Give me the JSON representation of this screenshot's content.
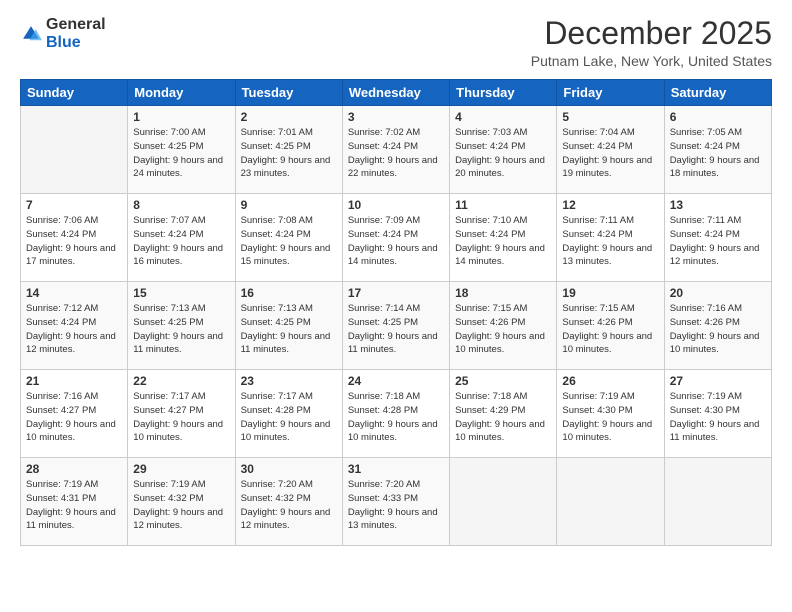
{
  "logo": {
    "general": "General",
    "blue": "Blue"
  },
  "header": {
    "month": "December 2025",
    "location": "Putnam Lake, New York, United States"
  },
  "weekdays": [
    "Sunday",
    "Monday",
    "Tuesday",
    "Wednesday",
    "Thursday",
    "Friday",
    "Saturday"
  ],
  "weeks": [
    [
      {
        "day": "",
        "sunrise": "",
        "sunset": "",
        "daylight": ""
      },
      {
        "day": "1",
        "sunrise": "Sunrise: 7:00 AM",
        "sunset": "Sunset: 4:25 PM",
        "daylight": "Daylight: 9 hours and 24 minutes."
      },
      {
        "day": "2",
        "sunrise": "Sunrise: 7:01 AM",
        "sunset": "Sunset: 4:25 PM",
        "daylight": "Daylight: 9 hours and 23 minutes."
      },
      {
        "day": "3",
        "sunrise": "Sunrise: 7:02 AM",
        "sunset": "Sunset: 4:24 PM",
        "daylight": "Daylight: 9 hours and 22 minutes."
      },
      {
        "day": "4",
        "sunrise": "Sunrise: 7:03 AM",
        "sunset": "Sunset: 4:24 PM",
        "daylight": "Daylight: 9 hours and 20 minutes."
      },
      {
        "day": "5",
        "sunrise": "Sunrise: 7:04 AM",
        "sunset": "Sunset: 4:24 PM",
        "daylight": "Daylight: 9 hours and 19 minutes."
      },
      {
        "day": "6",
        "sunrise": "Sunrise: 7:05 AM",
        "sunset": "Sunset: 4:24 PM",
        "daylight": "Daylight: 9 hours and 18 minutes."
      }
    ],
    [
      {
        "day": "7",
        "sunrise": "Sunrise: 7:06 AM",
        "sunset": "Sunset: 4:24 PM",
        "daylight": "Daylight: 9 hours and 17 minutes."
      },
      {
        "day": "8",
        "sunrise": "Sunrise: 7:07 AM",
        "sunset": "Sunset: 4:24 PM",
        "daylight": "Daylight: 9 hours and 16 minutes."
      },
      {
        "day": "9",
        "sunrise": "Sunrise: 7:08 AM",
        "sunset": "Sunset: 4:24 PM",
        "daylight": "Daylight: 9 hours and 15 minutes."
      },
      {
        "day": "10",
        "sunrise": "Sunrise: 7:09 AM",
        "sunset": "Sunset: 4:24 PM",
        "daylight": "Daylight: 9 hours and 14 minutes."
      },
      {
        "day": "11",
        "sunrise": "Sunrise: 7:10 AM",
        "sunset": "Sunset: 4:24 PM",
        "daylight": "Daylight: 9 hours and 14 minutes."
      },
      {
        "day": "12",
        "sunrise": "Sunrise: 7:11 AM",
        "sunset": "Sunset: 4:24 PM",
        "daylight": "Daylight: 9 hours and 13 minutes."
      },
      {
        "day": "13",
        "sunrise": "Sunrise: 7:11 AM",
        "sunset": "Sunset: 4:24 PM",
        "daylight": "Daylight: 9 hours and 12 minutes."
      }
    ],
    [
      {
        "day": "14",
        "sunrise": "Sunrise: 7:12 AM",
        "sunset": "Sunset: 4:24 PM",
        "daylight": "Daylight: 9 hours and 12 minutes."
      },
      {
        "day": "15",
        "sunrise": "Sunrise: 7:13 AM",
        "sunset": "Sunset: 4:25 PM",
        "daylight": "Daylight: 9 hours and 11 minutes."
      },
      {
        "day": "16",
        "sunrise": "Sunrise: 7:13 AM",
        "sunset": "Sunset: 4:25 PM",
        "daylight": "Daylight: 9 hours and 11 minutes."
      },
      {
        "day": "17",
        "sunrise": "Sunrise: 7:14 AM",
        "sunset": "Sunset: 4:25 PM",
        "daylight": "Daylight: 9 hours and 11 minutes."
      },
      {
        "day": "18",
        "sunrise": "Sunrise: 7:15 AM",
        "sunset": "Sunset: 4:26 PM",
        "daylight": "Daylight: 9 hours and 10 minutes."
      },
      {
        "day": "19",
        "sunrise": "Sunrise: 7:15 AM",
        "sunset": "Sunset: 4:26 PM",
        "daylight": "Daylight: 9 hours and 10 minutes."
      },
      {
        "day": "20",
        "sunrise": "Sunrise: 7:16 AM",
        "sunset": "Sunset: 4:26 PM",
        "daylight": "Daylight: 9 hours and 10 minutes."
      }
    ],
    [
      {
        "day": "21",
        "sunrise": "Sunrise: 7:16 AM",
        "sunset": "Sunset: 4:27 PM",
        "daylight": "Daylight: 9 hours and 10 minutes."
      },
      {
        "day": "22",
        "sunrise": "Sunrise: 7:17 AM",
        "sunset": "Sunset: 4:27 PM",
        "daylight": "Daylight: 9 hours and 10 minutes."
      },
      {
        "day": "23",
        "sunrise": "Sunrise: 7:17 AM",
        "sunset": "Sunset: 4:28 PM",
        "daylight": "Daylight: 9 hours and 10 minutes."
      },
      {
        "day": "24",
        "sunrise": "Sunrise: 7:18 AM",
        "sunset": "Sunset: 4:28 PM",
        "daylight": "Daylight: 9 hours and 10 minutes."
      },
      {
        "day": "25",
        "sunrise": "Sunrise: 7:18 AM",
        "sunset": "Sunset: 4:29 PM",
        "daylight": "Daylight: 9 hours and 10 minutes."
      },
      {
        "day": "26",
        "sunrise": "Sunrise: 7:19 AM",
        "sunset": "Sunset: 4:30 PM",
        "daylight": "Daylight: 9 hours and 10 minutes."
      },
      {
        "day": "27",
        "sunrise": "Sunrise: 7:19 AM",
        "sunset": "Sunset: 4:30 PM",
        "daylight": "Daylight: 9 hours and 11 minutes."
      }
    ],
    [
      {
        "day": "28",
        "sunrise": "Sunrise: 7:19 AM",
        "sunset": "Sunset: 4:31 PM",
        "daylight": "Daylight: 9 hours and 11 minutes."
      },
      {
        "day": "29",
        "sunrise": "Sunrise: 7:19 AM",
        "sunset": "Sunset: 4:32 PM",
        "daylight": "Daylight: 9 hours and 12 minutes."
      },
      {
        "day": "30",
        "sunrise": "Sunrise: 7:20 AM",
        "sunset": "Sunset: 4:32 PM",
        "daylight": "Daylight: 9 hours and 12 minutes."
      },
      {
        "day": "31",
        "sunrise": "Sunrise: 7:20 AM",
        "sunset": "Sunset: 4:33 PM",
        "daylight": "Daylight: 9 hours and 13 minutes."
      },
      {
        "day": "",
        "sunrise": "",
        "sunset": "",
        "daylight": ""
      },
      {
        "day": "",
        "sunrise": "",
        "sunset": "",
        "daylight": ""
      },
      {
        "day": "",
        "sunrise": "",
        "sunset": "",
        "daylight": ""
      }
    ]
  ]
}
